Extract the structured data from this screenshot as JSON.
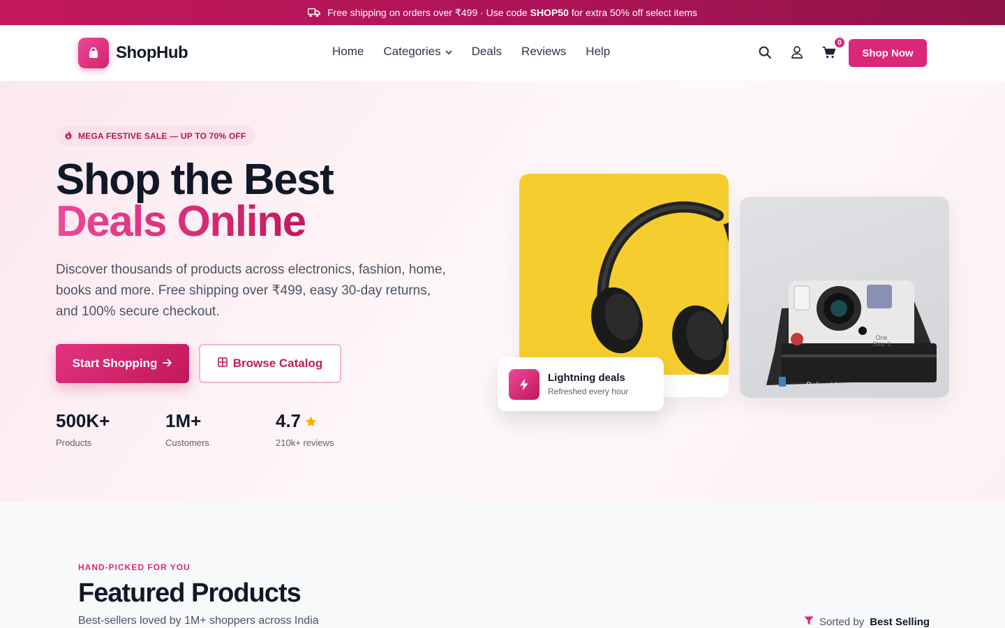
{
  "colors": {
    "brand": "#db2777",
    "brand_dark": "#c2185b",
    "text_dark": "#111827",
    "yellow": "#f6cd2f",
    "star": "#f5b301"
  },
  "announcement": {
    "icon": "truck-icon",
    "text_before": "Free shipping on orders over ₹499 · Use code ",
    "code": "SHOP50",
    "text_after": " for extra 50% off select items"
  },
  "header": {
    "logo_text": "ShopHub",
    "logo_icon": "shopping-bag-icon",
    "nav": [
      {
        "label": "Home"
      },
      {
        "label": "Categories",
        "has_dropdown": true
      },
      {
        "label": "Deals"
      },
      {
        "label": "Reviews"
      },
      {
        "label": "Help"
      }
    ],
    "cart_count": "0",
    "cta_label": "Shop Now"
  },
  "hero": {
    "badge": "MEGA FESTIVE SALE — UP TO 70% OFF",
    "badge_icon": "fire-icon",
    "title_line1": "Shop the Best",
    "title_line2": "Deals Online",
    "description": "Discover thousands of products across electronics, fashion, home, books and more. Free shipping over ₹499, easy 30-day returns, and 100% secure checkout.",
    "primary_button": "Start Shopping",
    "secondary_button": "Browse Catalog",
    "stats": [
      {
        "value": "500K+",
        "label": "Products"
      },
      {
        "value": "1M+",
        "label": "Customers"
      },
      {
        "value": "4.7",
        "label": "210k+ reviews",
        "icon": "star-icon"
      }
    ],
    "deal_card": {
      "title": "Lightning deals",
      "subtitle": "Refreshed every hour",
      "icon": "bolt-icon"
    },
    "camera_text": {
      "brand": "Polaroid",
      "model": "One Step 2"
    }
  },
  "featured": {
    "eyebrow": "HAND-PICKED FOR YOU",
    "title": "Featured Products",
    "subtitle": "Best-sellers loved by 1M+ shoppers across India",
    "sort_label": "Sorted by",
    "sort_value": "Best Selling",
    "sort_icon": "filter-icon"
  }
}
